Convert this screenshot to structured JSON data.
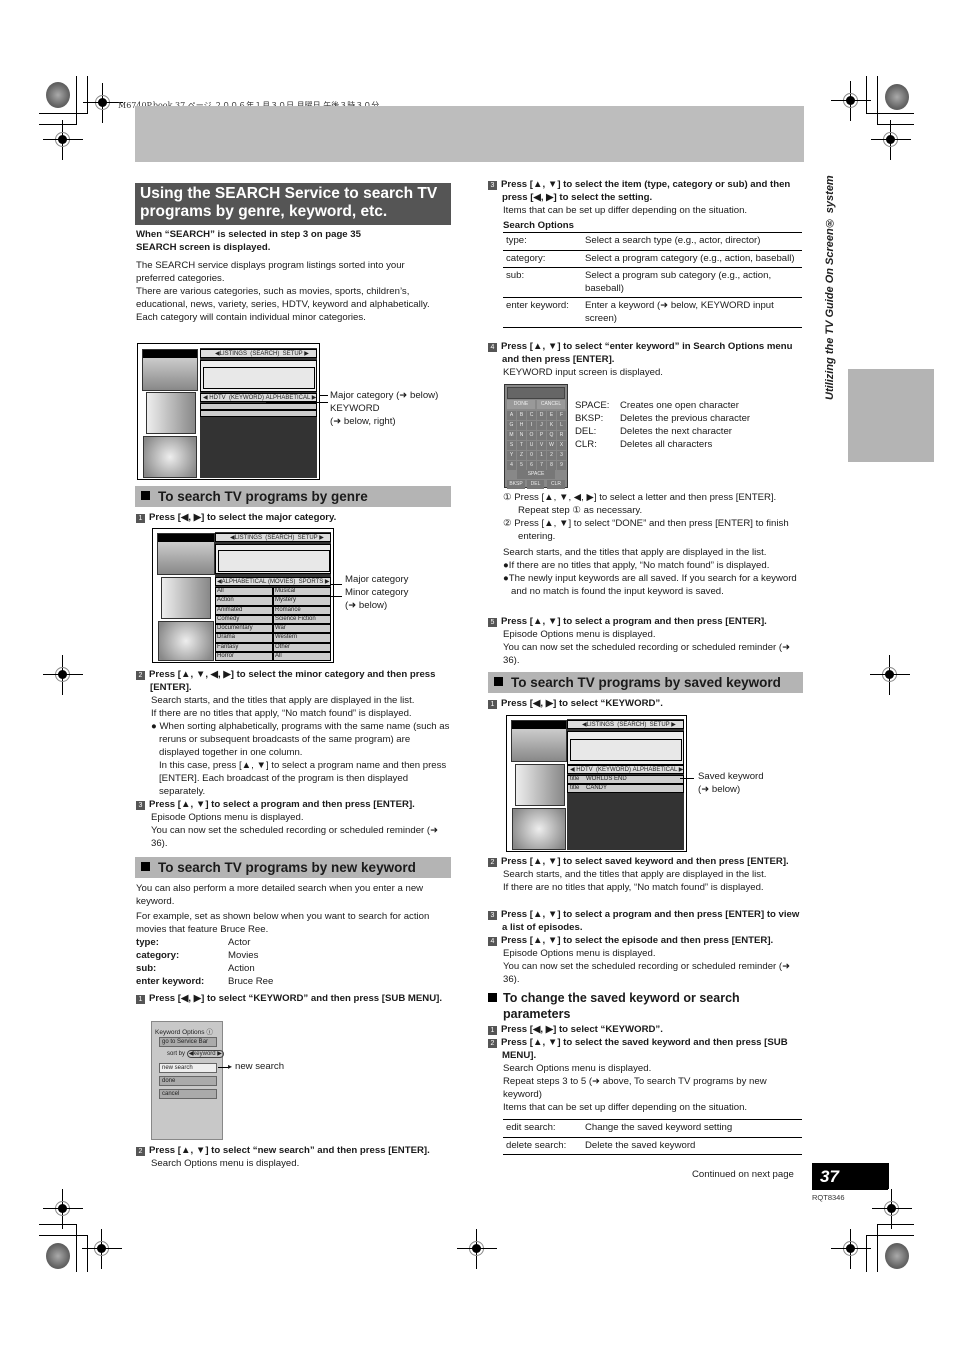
{
  "print_header": "M6740P.book  37 ページ  ２００６年１月３０日  月曜日  午後３時３０分",
  "side_label": "Utilizing the TV Guide On Screen® system",
  "title": "Using the SEARCH Service to search TV programs by genre, keyword, etc.",
  "intro": {
    "condition": "When “SEARCH” is selected in step 3 on page 35 SEARCH screen is displayed.",
    "para1": "The SEARCH service displays program listings sorted into your preferred categories.",
    "para2": "There are various categories, such as movies, sports, children’s, educational, news, variety, series, HDTV, keyword and alphabetically. Each category will contain individual minor categories."
  },
  "screen1": {
    "tabs": [
      "◀LISTINGS",
      "SEARCH",
      "SETUP ▶"
    ],
    "category_bar": [
      "◀ HDTV",
      "KEYWORD",
      "ALPHABETICAL ▶"
    ],
    "callout_major": "Major category (➜ below)",
    "callout_keyword": "KEYWORD",
    "callout_keyword_ref": "(➜ below, right)"
  },
  "genre": {
    "heading": "To search TV programs by genre",
    "step1": "Press [◀, ▶] to select the major category.",
    "screen": {
      "tabs": [
        "◀LISTINGS",
        "SEARCH",
        "SETUP ▶"
      ],
      "category_bar": [
        "◀ALPHABETICAL",
        "MOVIES",
        "SPORTS ▶"
      ],
      "minor_left": [
        "All",
        "Action",
        "Animated",
        "Comedy",
        "Documentary",
        "Drama",
        "Fantasy",
        "Horror"
      ],
      "minor_right": [
        "Musical",
        "Mystery",
        "Romance",
        "Science Fiction",
        "War",
        "Western",
        "Other",
        "All"
      ],
      "callout_major": "Major category",
      "callout_minor": "Minor category",
      "callout_minor_ref": "(➜ below)"
    },
    "step2_lead": "Press [▲, ▼, ◀, ▶] to select the minor category and then press [ENTER].",
    "step2_body1": "Search starts, and the titles that apply are displayed in the list.",
    "step2_body2": "If there are no titles that apply, “No match found” is displayed.",
    "step2_bullet": "When sorting alphabetically, programs with the same name (such as reruns or subsequent broadcasts of the same program) are displayed together in one column.",
    "step2_bullet2": "In this case, press [▲, ▼] to select a program name and then press [ENTER]. Each broadcast of the program is then displayed separately.",
    "step3_lead": "Press [▲, ▼] to select a program and then press [ENTER].",
    "step3_body1": "Episode Options menu is displayed.",
    "step3_body2": "You can now set the scheduled recording or scheduled reminder (➜ 36)."
  },
  "newkw": {
    "heading": "To search TV programs by new keyword",
    "para1": "You can also perform a more detailed search when you enter a new keyword.",
    "para2": "For example, set as shown below when you want to search for action movies that feature Bruce Ree.",
    "example": [
      {
        "k": "type:",
        "v": "Actor"
      },
      {
        "k": "category:",
        "v": "Movies"
      },
      {
        "k": "sub:",
        "v": "Action"
      },
      {
        "k": "enter keyword:",
        "v": "Bruce Ree"
      }
    ],
    "step1_lead": "Press [◀, ▶] to select “KEYWORD” and then press [SUB MENU].",
    "menu": {
      "title": "Keyword Options",
      "items": [
        "go to Service Bar",
        "new search",
        "done",
        "cancel"
      ],
      "sort_label": "sort by",
      "sort_value": "◀keyword ▶",
      "callout": "new search"
    },
    "step2_lead": "Press [▲, ▼] to select “new search” and then press [ENTER].",
    "step2_body": "Search Options menu is displayed.",
    "step3_lead": "Press [▲, ▼] to select the item (type, category or sub) and then press [◀, ▶] to select the setting.",
    "step3_body": "Items that can be set up differ depending on the situation.",
    "options_title": "Search Options",
    "options": [
      {
        "k": "type:",
        "v": "Select a search type (e.g., actor, director)"
      },
      {
        "k": "category:",
        "v": "Select a program category (e.g., action, baseball)"
      },
      {
        "k": "sub:",
        "v": "Select a program sub category (e.g., action, baseball)"
      },
      {
        "k": "enter keyword:",
        "v": "Enter a keyword (➜ below, KEYWORD input screen)"
      }
    ],
    "step4_lead": "Press [▲, ▼] to select “enter keyword” in Search Options menu and then press [ENTER].",
    "step4_body": "KEYWORD input screen is displayed.",
    "keyboard": {
      "done": "DONE",
      "cancel": "CANCEL",
      "keys": [
        "A",
        "B",
        "C",
        "D",
        "E",
        "F",
        "G",
        "H",
        "I",
        "J",
        "K",
        "L",
        "M",
        "N",
        "O",
        "P",
        "Q",
        "R",
        "S",
        "T",
        "U",
        "V",
        "W",
        "X",
        "Y",
        "Z",
        "0",
        "1",
        "2",
        "3",
        "4",
        "5",
        "6",
        "7",
        "8",
        "9"
      ],
      "space": "SPACE",
      "bksp": "BKSP",
      "del": "DEL",
      "clr": "CLR"
    },
    "key_legend": [
      {
        "k": "SPACE:",
        "v": "Creates one open character"
      },
      {
        "k": "BKSP:",
        "v": "Deletes the previous character"
      },
      {
        "k": "DEL:",
        "v": "Deletes the next character"
      },
      {
        "k": "CLR:",
        "v": "Deletes all characters"
      }
    ],
    "sub1": "① Press [▲, ▼, ◀, ▶] to select a letter and then press [ENTER].",
    "sub1b": "Repeat step ① as necessary.",
    "sub2": "② Press [▲, ▼] to select “DONE” and then press [ENTER] to finish entering.",
    "result": "Search starts, and the titles that apply are displayed in the list.",
    "bullet1": "If there are no titles that apply, “No match found” is displayed.",
    "bullet2": "The newly input keywords are all saved. If you search for a keyword and no match is found the input keyword is saved.",
    "step5_lead": "Press [▲, ▼] to select a program and then press [ENTER].",
    "step5_body1": "Episode Options menu is displayed.",
    "step5_body2": "You can now set the scheduled recording or scheduled reminder (➜ 36)."
  },
  "savedkw": {
    "heading": "To search TV programs by saved keyword",
    "step1_lead": "Press [◀, ▶] to select “KEYWORD”.",
    "screen": {
      "tabs": [
        "◀LISTINGS",
        "SEARCH",
        "SETUP ▶"
      ],
      "category_bar": [
        "◀ HDTV",
        "KEYWORD",
        "ALPHABETICAL ▶"
      ],
      "rows": [
        {
          "label": "title",
          "value": "WORLDS END"
        },
        {
          "label": "title",
          "value": "CANDY"
        }
      ],
      "callout": "Saved keyword",
      "callout_ref": "(➜ below)"
    },
    "step2_lead": "Press [▲, ▼] to select saved keyword and then press [ENTER].",
    "step2_body1": "Search starts, and the titles that apply are displayed in the list.",
    "step2_body2": "If there are no titles that apply, “No match found” is displayed.",
    "step3_lead": "Press [▲, ▼] to select a program and then press [ENTER] to view a list of episodes.",
    "step4_lead": "Press [▲, ▼] to select the episode and then press [ENTER].",
    "step4_body1": "Episode Options menu is displayed.",
    "step4_body2": "You can now set the scheduled recording or scheduled reminder (➜ 36)."
  },
  "change": {
    "heading": "To change the saved keyword or search parameters",
    "step1_lead": "Press [◀, ▶] to select “KEYWORD”.",
    "step2_lead": "Press [▲, ▼] to select the saved keyword and then press [SUB MENU].",
    "body1": "Search Options menu is displayed.",
    "body2": "Repeat steps 3 to 5 (➜ above, To search TV programs by new keyword)",
    "body3": "Items that can be set up differ depending on the situation.",
    "options": [
      {
        "k": "edit search:",
        "v": "Change the saved keyword setting"
      },
      {
        "k": "delete search:",
        "v": "Delete the saved keyword"
      }
    ]
  },
  "footer": {
    "continued": "Continued on next page",
    "page_number": "37",
    "code": "RQT8346"
  },
  "step_numbers": [
    "1",
    "2",
    "3",
    "4",
    "5"
  ]
}
